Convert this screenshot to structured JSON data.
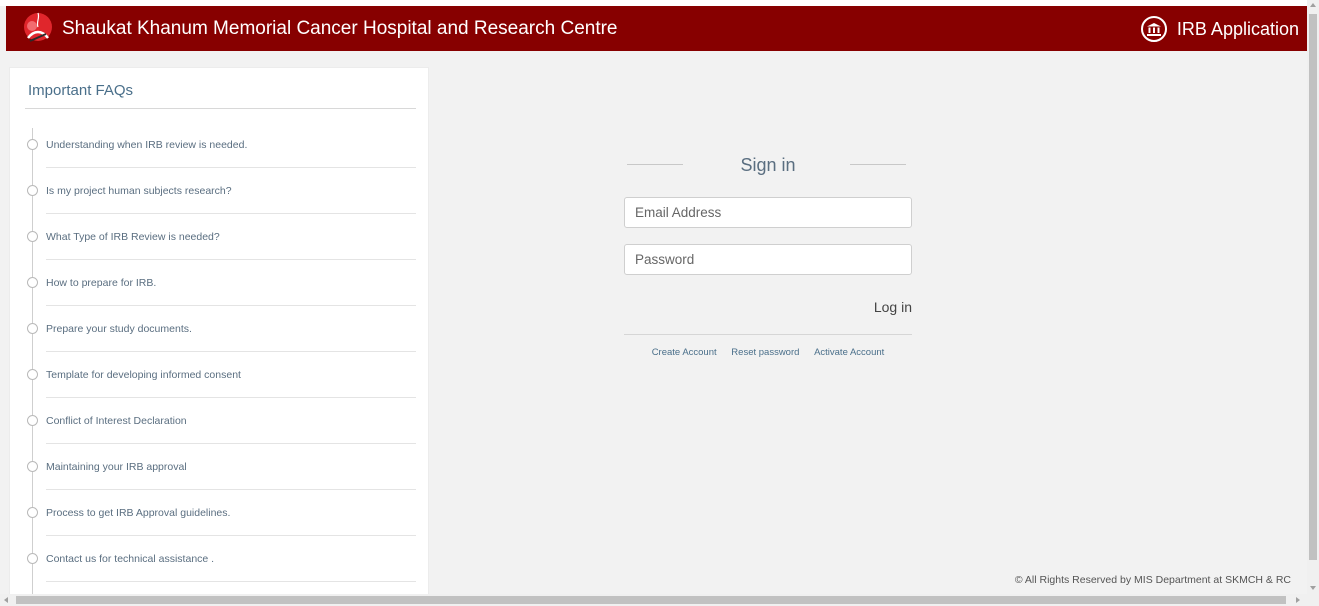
{
  "header": {
    "brand": "Shaukat Khanum Memorial Cancer Hospital and Research Centre",
    "app_title": "IRB Application",
    "logo_icon": "ribbon-logo-icon",
    "app_icon": "institution-building-icon",
    "background_color": "#870000"
  },
  "faq": {
    "heading": "Important FAQs",
    "items": [
      "Understanding when IRB review is needed.",
      "Is my project human subjects research?",
      "What Type of IRB Review is needed?",
      "How to prepare for IRB.",
      "Prepare your study documents.",
      "Template for developing informed consent",
      "Conflict of Interest Declaration",
      "Maintaining your IRB approval",
      "Process to get IRB Approval guidelines.",
      "Contact us for technical assistance ."
    ]
  },
  "signin": {
    "title": "Sign in",
    "email_placeholder": "Email Address",
    "password_placeholder": "Password",
    "login_label": "Log in",
    "links": {
      "create_account": "Create Account",
      "reset_password": "Reset password",
      "activate_account": "Activate Account"
    }
  },
  "footer": {
    "copyright": "© All Rights Reserved by MIS Department at SKMCH & RC"
  }
}
